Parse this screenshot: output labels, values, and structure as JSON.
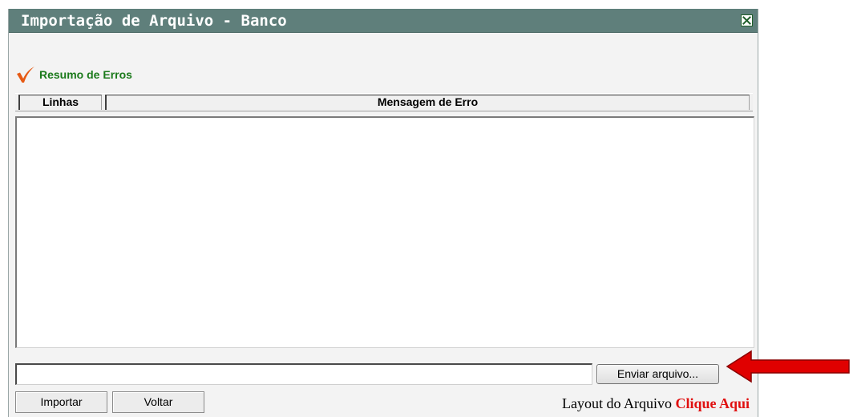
{
  "window": {
    "title": "Importação de Arquivo - Banco",
    "close_icon": "close-x-icon"
  },
  "section": {
    "icon": "checkmark-icon",
    "title": "Resumo de Erros"
  },
  "table": {
    "columns": [
      "Linhas",
      "Mensagem de Erro"
    ],
    "rows": []
  },
  "file_input": {
    "value": "",
    "browse_label": "Enviar arquivo..."
  },
  "actions": {
    "import_label": "Importar",
    "back_label": "Voltar"
  },
  "layout_info": {
    "text": "Layout do Arquivo",
    "link_text": "Clique Aqui"
  },
  "annotation": {
    "icon": "arrow-left-icon"
  },
  "colors": {
    "titlebar": "#5f7f7b",
    "section_title": "#1b7a1b",
    "checkmark": "#e65a14",
    "link": "#e01010",
    "arrow": "#e00000"
  }
}
